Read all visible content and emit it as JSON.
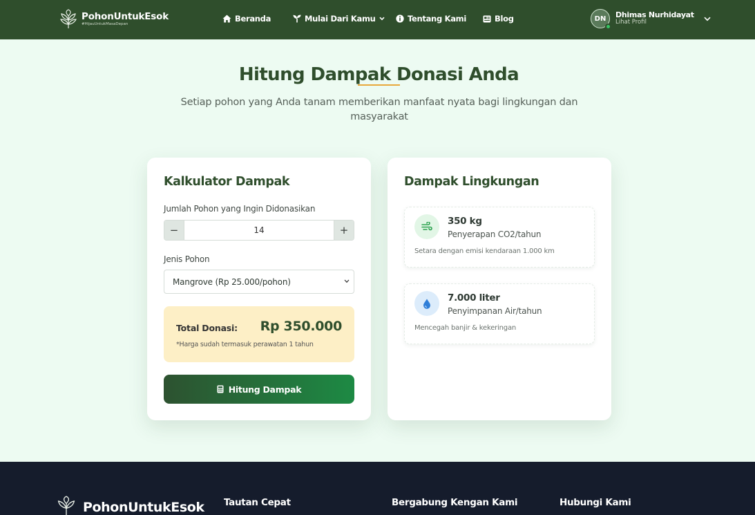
{
  "brand": {
    "name": "PohonUntukEsok",
    "tagline": "#HijauUntukMasaDepan"
  },
  "nav": {
    "home": {
      "label": "Beranda",
      "icon": "home-icon"
    },
    "start": {
      "label": "Mulai Dari Kamu",
      "icon": "sprout-icon"
    },
    "about": {
      "label": "Tentang Kami",
      "icon": "info-icon"
    },
    "blog": {
      "label": "Blog",
      "icon": "newspaper-icon"
    }
  },
  "user": {
    "initials": "DN",
    "name": "Dhimas Nurhidayat",
    "profile_link": "Lihat Profil"
  },
  "hero": {
    "title": "Hitung Dampak Donasi Anda",
    "subtitle": "Setiap pohon yang Anda tanam memberikan manfaat nyata bagi lingkungan dan masyarakat"
  },
  "calculator": {
    "title": "Kalkulator Dampak",
    "quantity_label": "Jumlah Pohon yang Ingin Didonasikan",
    "minus": "−",
    "plus": "+",
    "quantity": "14",
    "type_label": "Jenis Pohon",
    "type_selected": "Mangrove (Rp 25.000/pohon)",
    "total_label": "Total Donasi:",
    "total_value": "Rp 350.000",
    "total_note": "*Harga sudah termasuk perawatan 1 tahun",
    "button_label": "Hitung Dampak"
  },
  "impact": {
    "title": "Dampak Lingkungan",
    "items": [
      {
        "value": "350 kg",
        "unit": "Penyerapan CO2/tahun",
        "desc": "Setara dengan emisi kendaraan 1.000 km",
        "icon": "wind-icon"
      },
      {
        "value": "7.000 liter",
        "unit": "Penyimpanan Air/tahun",
        "desc": "Mencegah banjir & kekeringan",
        "icon": "water-drop-icon"
      }
    ]
  },
  "footer": {
    "brand": "PohonUntukEsok",
    "col1": "Tautan Cepat",
    "col2": "Bergabung Kengan Kami",
    "col3": "Hubungi Kami"
  },
  "colors": {
    "primary": "#2f4e2c",
    "accent": "#e8a73a",
    "background": "#edfbf2",
    "footer": "#151c2c",
    "button_gradient_end": "#1d8a44"
  }
}
